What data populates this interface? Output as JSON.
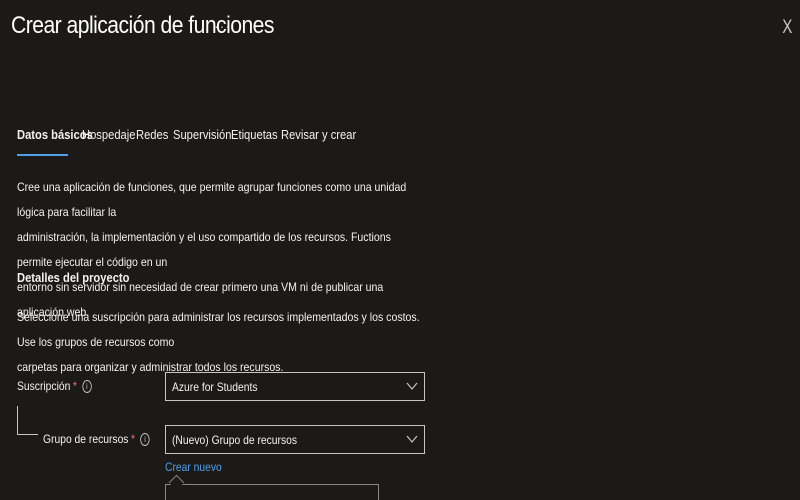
{
  "header": {
    "title": "Crear aplicación de funciones",
    "more_label": "···",
    "close_label": "X"
  },
  "tabs": [
    {
      "label": "Datos básicos",
      "active": true
    },
    {
      "label": "Hospedaje",
      "active": false
    },
    {
      "label": "Redes",
      "active": false
    },
    {
      "label": "Supervisión",
      "active": false
    },
    {
      "label": "Etiquetas",
      "active": false
    },
    {
      "label": "Revisar y crear",
      "active": false
    }
  ],
  "intro": {
    "line1": "Cree una aplicación de funciones, que permite agrupar funciones como una unidad lógica para facilitar la",
    "line2": "administración, la implementación y el uso compartido de los recursos. Fuctions permite ejecutar el código en un",
    "line3": "entorno sin servidor sin necesidad de crear primero una VM ni de publicar una aplicación web."
  },
  "project_details": {
    "heading": "Detalles del proyecto",
    "description_line1": "Seleccione una suscripción para administrar los recursos implementados y los costos. Use los grupos de recursos como",
    "description_line2": "carpetas para organizar y administrar todos los recursos.",
    "subscription": {
      "label": "Suscripción",
      "required_mark": "*",
      "info_icon": "i",
      "value": "Azure for Students"
    },
    "resource_group": {
      "label": "Grupo de recursos",
      "required_mark": "*",
      "info_icon": "i",
      "value": "(Nuevo) Grupo de recursos",
      "create_new_link": "Crear nuevo"
    }
  },
  "colors": {
    "background": "#1b1a19",
    "accent": "#4f9fe8",
    "required": "#f1707b",
    "border": "#c8c6c4"
  }
}
